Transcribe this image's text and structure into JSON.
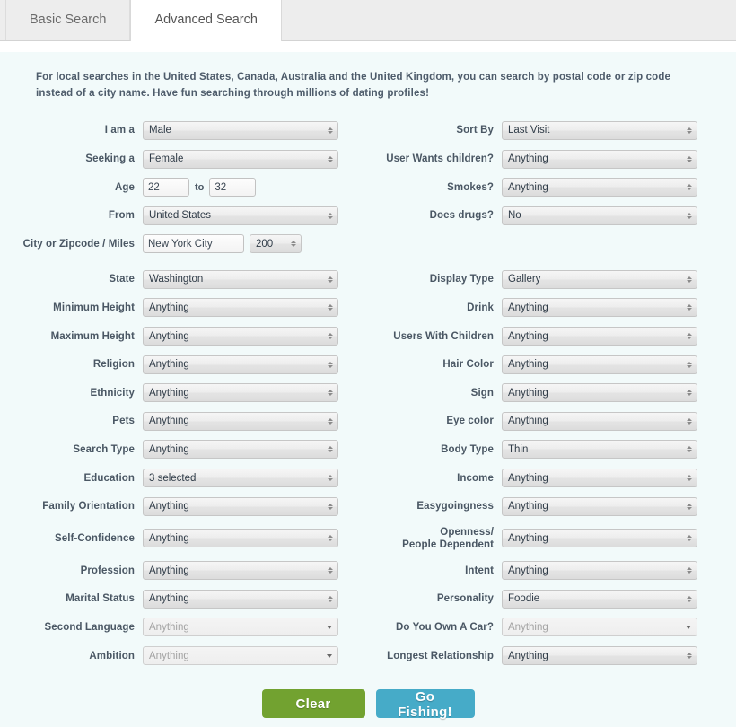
{
  "tabs": [
    {
      "label": "Basic Search",
      "active": false
    },
    {
      "label": "Advanced Search",
      "active": true
    }
  ],
  "intro": "For local searches in the United States, Canada, Australia and the United Kingdom, you can search by postal code or zip code instead of a city name. Have fun searching through millions of dating profiles!",
  "left_column": {
    "i_am_a": {
      "label": "I am a",
      "value": "Male"
    },
    "seeking_a": {
      "label": "Seeking a",
      "value": "Female"
    },
    "age": {
      "label": "Age",
      "from": "22",
      "to_word": "to",
      "to": "32"
    },
    "from": {
      "label": "From",
      "value": "United States"
    },
    "city_zip_miles": {
      "label": "City or Zipcode / Miles",
      "city": "New York City",
      "miles": "200"
    },
    "state": {
      "label": "State",
      "value": "Washington"
    },
    "minimum_height": {
      "label": "Minimum Height",
      "value": "Anything"
    },
    "maximum_height": {
      "label": "Maximum Height",
      "value": "Anything"
    },
    "religion": {
      "label": "Religion",
      "value": "Anything"
    },
    "ethnicity": {
      "label": "Ethnicity",
      "value": "Anything"
    },
    "pets": {
      "label": "Pets",
      "value": "Anything"
    },
    "search_type": {
      "label": "Search Type",
      "value": "Anything"
    },
    "education": {
      "label": "Education",
      "value": "3 selected"
    },
    "family_orientation": {
      "label": "Family Orientation",
      "value": "Anything"
    },
    "self_confidence": {
      "label": "Self-Confidence",
      "value": "Anything"
    },
    "profession": {
      "label": "Profession",
      "value": "Anything"
    },
    "marital_status": {
      "label": "Marital Status",
      "value": "Anything"
    },
    "second_language": {
      "label": "Second Language",
      "value": "Anything"
    },
    "ambition": {
      "label": "Ambition",
      "value": "Anything"
    }
  },
  "right_column": {
    "sort_by": {
      "label": "Sort By",
      "value": "Last Visit"
    },
    "user_wants_children": {
      "label": "User Wants children?",
      "value": "Anything"
    },
    "smokes": {
      "label": "Smokes?",
      "value": "Anything"
    },
    "does_drugs": {
      "label": "Does drugs?",
      "value": "No"
    },
    "display_type": {
      "label": "Display Type",
      "value": "Gallery"
    },
    "drink": {
      "label": "Drink",
      "value": "Anything"
    },
    "users_with_children": {
      "label": "Users With Children",
      "value": "Anything"
    },
    "hair_color": {
      "label": "Hair Color",
      "value": "Anything"
    },
    "sign": {
      "label": "Sign",
      "value": "Anything"
    },
    "eye_color": {
      "label": "Eye color",
      "value": "Anything"
    },
    "body_type": {
      "label": "Body Type",
      "value": "Thin"
    },
    "income": {
      "label": "Income",
      "value": "Anything"
    },
    "easygoingness": {
      "label": "Easygoingness",
      "value": "Anything"
    },
    "openness": {
      "label_line1": "Openness/",
      "label_line2": "People Dependent",
      "value": "Anything"
    },
    "intent": {
      "label": "Intent",
      "value": "Anything"
    },
    "personality": {
      "label": "Personality",
      "value": "Foodie"
    },
    "own_a_car": {
      "label": "Do You Own A Car?",
      "value": "Anything"
    },
    "longest_relationship": {
      "label": "Longest Relationship",
      "value": "Anything"
    }
  },
  "buttons": {
    "clear": "Clear",
    "go_fishing": "Go Fishing!"
  },
  "colors": {
    "clear_green": "#72a230",
    "go_blue": "#46abc8",
    "panel_bg": "#f2fafa",
    "label_text": "#4a5764"
  }
}
